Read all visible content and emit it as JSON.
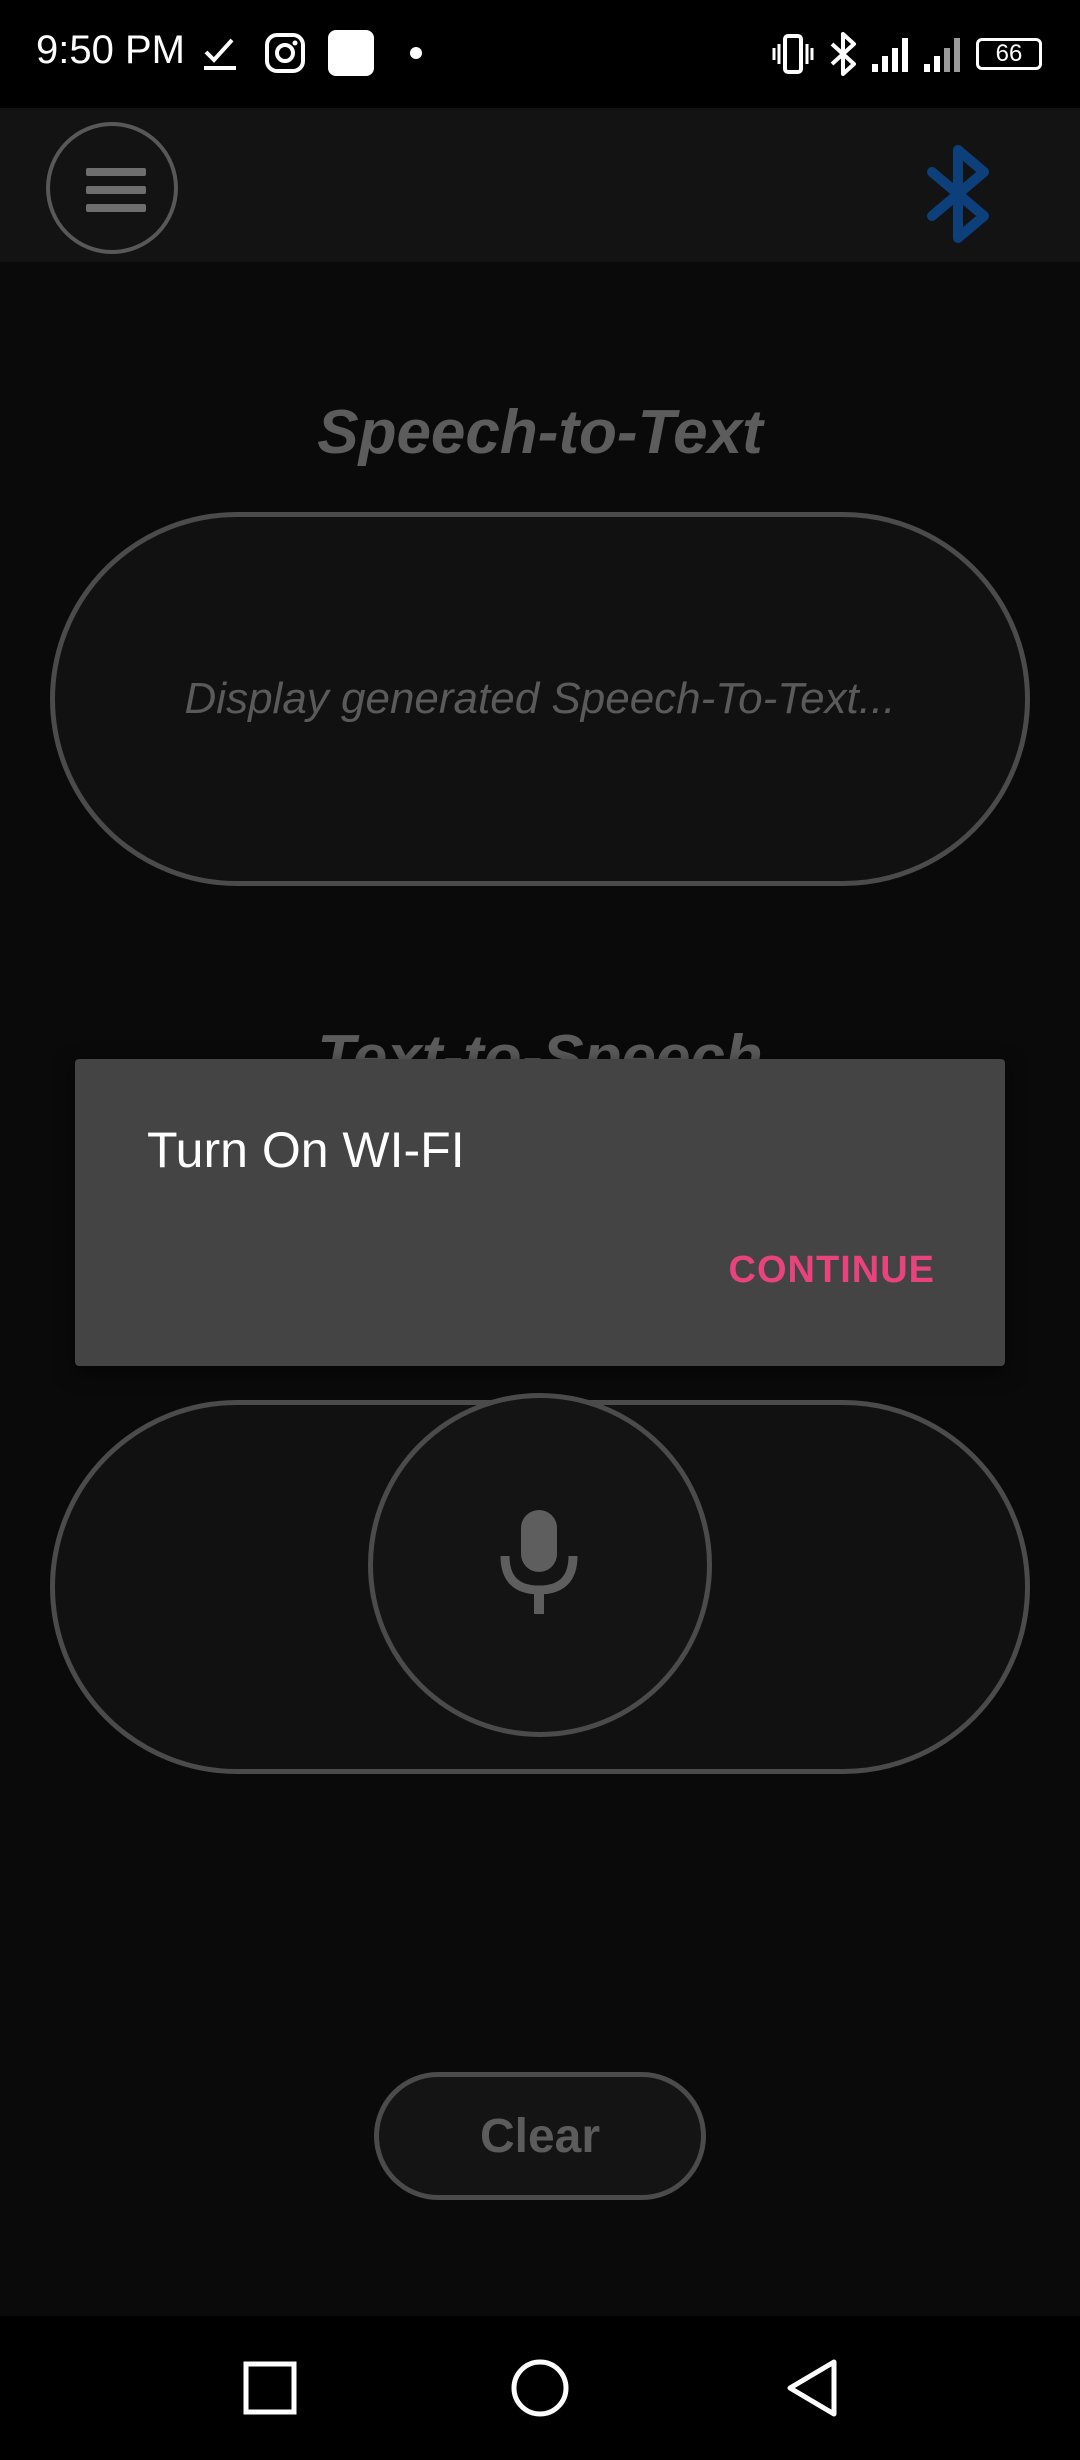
{
  "status_bar": {
    "time": "9:50 PM",
    "battery": "66",
    "icons": [
      "checkmark-download-icon",
      "instagram-icon",
      "white-square-icon",
      "dot-icon",
      "vibrate-icon",
      "bluetooth-status-icon",
      "signal-icon",
      "signal-2-icon",
      "battery-icon"
    ]
  },
  "app_bar": {
    "menu_icon": "hamburger-menu-icon",
    "bluetooth_icon": "bluetooth-icon",
    "bluetooth_color": "#0d3f7a"
  },
  "main": {
    "stt_title": "Speech-to-Text",
    "stt_placeholder": "Display generated Speech-To-Text...",
    "tts_title": "Text-to-Speech",
    "mic_icon": "microphone-icon",
    "clear_label": "Clear"
  },
  "dialog": {
    "title": "Turn On WI-FI",
    "action_label": "CONTINUE",
    "action_color": "#e8437c"
  },
  "nav_bar": {
    "recents_icon": "square-recents-icon",
    "home_icon": "circle-home-icon",
    "back_icon": "triangle-back-icon"
  }
}
